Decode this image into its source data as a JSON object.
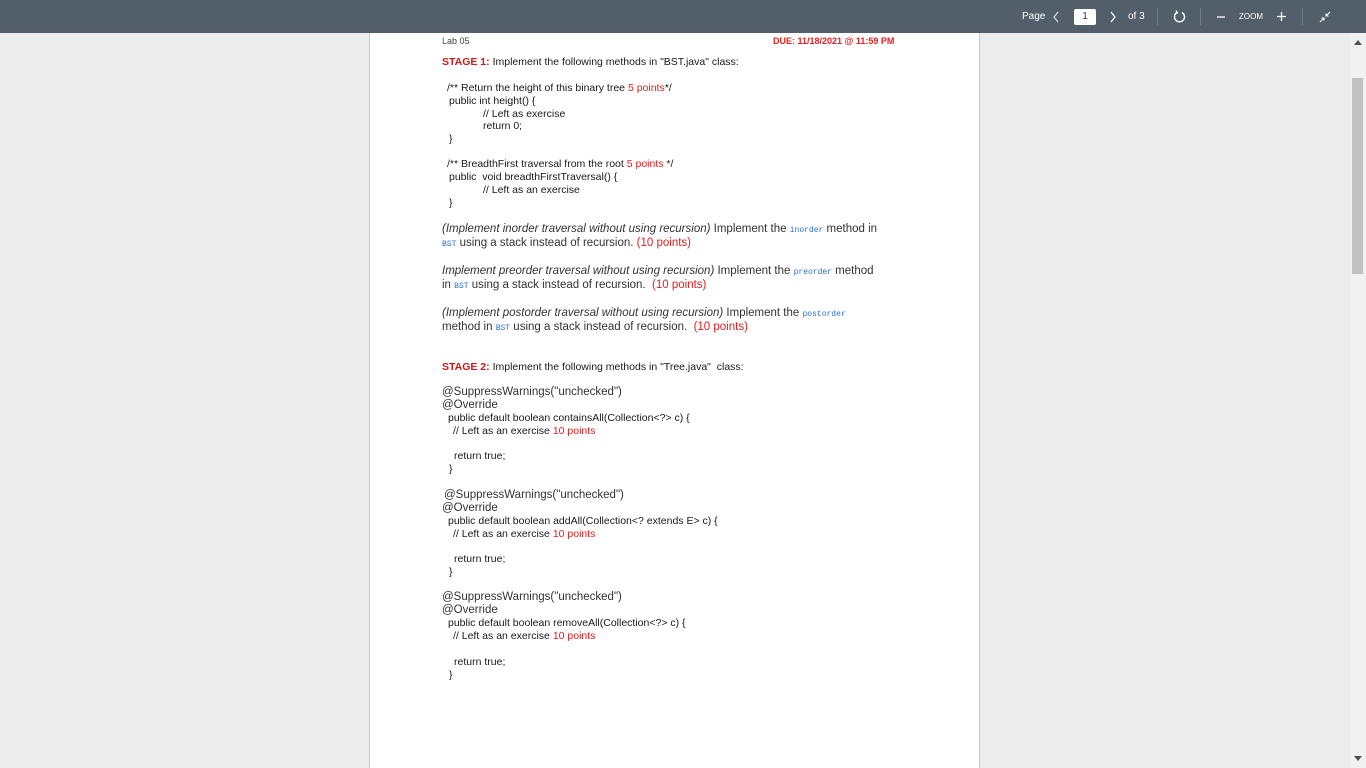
{
  "toolbar": {
    "page_label": "Page",
    "current_page": "1",
    "of_pages": "of 3",
    "zoom_label": "ZOOM"
  },
  "doc": {
    "header_left": "Lab 05",
    "header_right": "DUE: 11/18/2021 @ 11:59 PM",
    "stage1_title": "STAGE 1:",
    "stage1_text": " Implement the following methods in \"BST.java\" class:",
    "h_comment": "/** Return the height of this binary tree ",
    "h_points": "5 points",
    "h_end": "*/",
    "h_sig": "public int height() {",
    "h_l1": "// Left as exercise",
    "h_l2": "return 0;",
    "h_close": "}",
    "b_comment": "/** BreadthFirst traversal from the root ",
    "b_points": "5 points",
    "b_end": " */",
    "b_sig": "public  void breadthFirstTraversal() {",
    "b_l1": "// Left as an exercise",
    "b_close": "}",
    "in_a": "(Implement inorder traversal without using recursion)",
    "in_b": " Implement the ",
    "in_code": "inorder",
    "in_c": " method in",
    "in_code2": "BST",
    "in_d": " using a stack instead of recursion. ",
    "in_pts": "(10 points)",
    "pre_a": "Implement preorder traversal without using recursion)",
    "pre_b": " Implement the ",
    "pre_code": "preorder",
    "pre_c": " method",
    "pre_d1": "in ",
    "pre_code2": "BST",
    "pre_d": " using a stack instead of recursion.  ",
    "pre_pts": "(10 points)",
    "post_a": "(Implement postorder traversal without using recursion)",
    "post_b": " Implement the ",
    "post_code": "postorder",
    "post_d1": "method in ",
    "post_code2": "BST",
    "post_d": " using a stack instead of recursion.  ",
    "post_pts": "(10 points)",
    "stage2_title": "STAGE 2:",
    "stage2_text": " Implement the following methods in \"Tree.java\"  class:",
    "ca_ann": "@SuppressWarnings(\"unchecked\")",
    "ca_ov": "@Override",
    "ca_sig": "public default boolean containsAll(Collection<?> c) {",
    "ca_l1": "// Left as an exercise ",
    "ca_pts": "10 points",
    "ca_ret": "return true;",
    "ca_close": "}",
    "aa_ann": "@SuppressWarnings(\"unchecked\")",
    "aa_ov": "@Override",
    "aa_sig": "public default boolean addAll(Collection<? extends E> c) {",
    "aa_l1": "// Left as an exercise ",
    "aa_pts": "10 points",
    "aa_ret": "return true;",
    "aa_close": "}",
    "ra_ann": "@SuppressWarnings(\"unchecked\")",
    "ra_ov": "@Override",
    "ra_sig": "public default boolean removeAll(Collection<?> c) {",
    "ra_l1": "// Left as an exercise ",
    "ra_pts": "10 points",
    "ra_ret": "return true;",
    "ra_close": "}"
  },
  "colors": {
    "toolbar": "#525f6b",
    "accent_red": "#e02020",
    "code_blue": "#2a6fd6"
  }
}
